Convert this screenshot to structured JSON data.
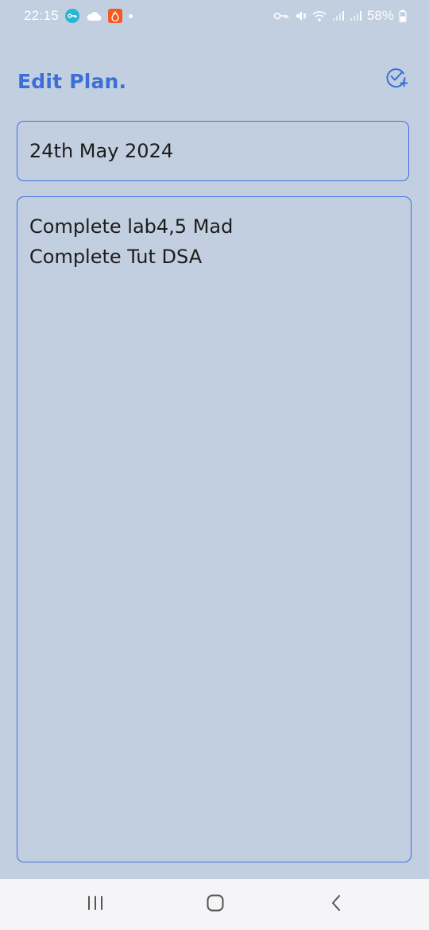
{
  "status_bar": {
    "time": "22:15",
    "battery": "58%",
    "left_icons": [
      "vpn-key-icon",
      "cloud-icon",
      "flame-app-icon",
      "notification-dot-icon"
    ],
    "right_icons": [
      "key-icon",
      "mute-icon",
      "wifi-icon",
      "signal-icon",
      "signal-icon",
      "battery-icon"
    ]
  },
  "header": {
    "title": "Edit Plan.",
    "save_icon": "check-circle-add-icon"
  },
  "form": {
    "date_value": "24th May 2024",
    "notes_lines": [
      "Complete lab4,5 Mad",
      "Complete Tut DSA"
    ]
  },
  "nav": {
    "recents_icon": "recents-icon",
    "home_icon": "home-icon",
    "back_icon": "back-icon"
  },
  "colors": {
    "background": "#c2cfe0",
    "accent": "#3c6fd6",
    "border": "#3d6fe0",
    "text": "#1c1c1c",
    "nav_background": "#f5f5f7"
  }
}
